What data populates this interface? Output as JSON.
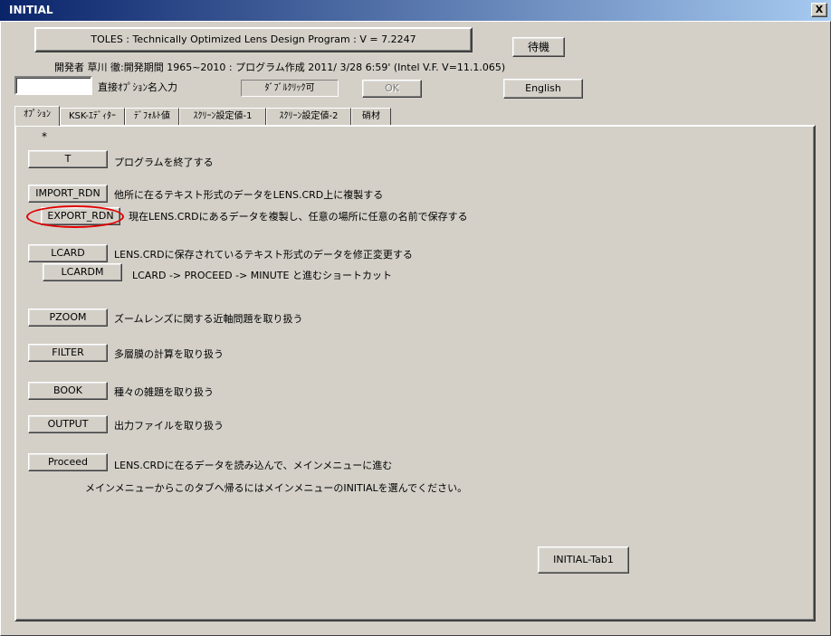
{
  "window": {
    "title": "INITIAL",
    "close_label": "X"
  },
  "header": {
    "program_title": "TOLES : Technically Optimized Lens Design Program : V =  7.2247",
    "wait_button": "待機",
    "author_line": "開発者 草川  徹:開発期間 1965~2010 : プログラム作成  2011/ 3/28   6:59' (Intel V.F. V=11.1.065)",
    "option_input_value": "",
    "option_input_label": "直接ｵﾌﾟｼｮﾝ名入力",
    "double_click_label": "ﾀﾞﾌﾞﾙｸﾘｯｸ可",
    "ok_button": "OK",
    "english_button": "English"
  },
  "tabs": [
    {
      "label": "ｵﾌﾟｼｮﾝ",
      "active": true
    },
    {
      "label": "KSK-ｴﾃﾞｨﾀｰ",
      "active": false
    },
    {
      "label": "ﾃﾞﾌｫﾙﾄ値",
      "active": false
    },
    {
      "label": "ｽｸﾘｰﾝ設定値-1",
      "active": false
    },
    {
      "label": "ｽｸﾘｰﾝ設定値-2",
      "active": false
    },
    {
      "label": "硝材",
      "active": false
    }
  ],
  "panel": {
    "asterisk": "*",
    "options": [
      {
        "button": "T",
        "desc": "プログラムを終了する"
      },
      {
        "button": "IMPORT_RDN",
        "desc": "他所に在るテキスト形式のデータをLENS.CRD上に複製する"
      },
      {
        "button": "EXPORT_RDN",
        "desc": "現在LENS.CRDにあるデータを複製し、任意の場所に任意の名前で保存する"
      },
      {
        "button": "LCARD",
        "desc": "LENS.CRDに保存されているテキスト形式のデータを修正変更する"
      },
      {
        "button": "LCARDM",
        "desc": "LCARD -> PROCEED -> MINUTE  と進むショートカット"
      },
      {
        "button": "PZOOM",
        "desc": "ズームレンズに関する近軸問題を取り扱う"
      },
      {
        "button": "FILTER",
        "desc": "多層膜の計算を取り扱う"
      },
      {
        "button": "BOOK",
        "desc": "種々の雑題を取り扱う"
      },
      {
        "button": "OUTPUT",
        "desc": "出力ファイルを取り扱う"
      },
      {
        "button": "Proceed",
        "desc": "LENS.CRDに在るデータを読み込んで、メインメニューに進む"
      }
    ],
    "note": "メインメニューからこのタブへ帰るにはメインメニューのINITIALを選んでください。",
    "tab_button": "INITIAL-Tab1"
  },
  "colors": {
    "face": "#d4d0c8",
    "title_start": "#0a246a",
    "title_end": "#a6caf0",
    "highlight_ellipse": "#e00000"
  }
}
